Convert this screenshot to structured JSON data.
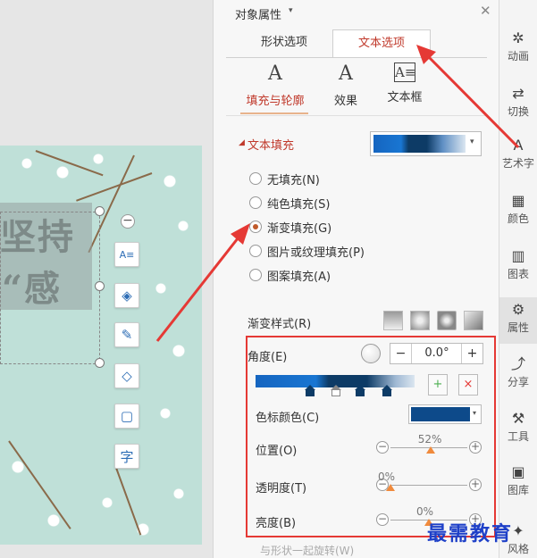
{
  "canvas": {
    "slide_text_line1": "坚持",
    "slide_text_line2": "“感",
    "float_tools": [
      {
        "icon": "text-style-icon",
        "glyph": "A≡"
      },
      {
        "icon": "layers-icon",
        "glyph": "◈"
      },
      {
        "icon": "brush-icon",
        "glyph": "✎"
      },
      {
        "icon": "fill-bucket-icon",
        "glyph": "◇"
      },
      {
        "icon": "frame-icon",
        "glyph": "▢"
      },
      {
        "icon": "font-icon",
        "glyph": "字"
      }
    ]
  },
  "panel": {
    "title": "对象属性",
    "title_caret": "▾",
    "close": "✕",
    "tabs": {
      "shape": "形状选项",
      "text": "文本选项"
    },
    "subtabs": {
      "fill_outline": {
        "icon": "A",
        "label": "填充与轮廓"
      },
      "effect": {
        "icon": "A",
        "label": "效果"
      },
      "textbox": {
        "icon": "A≡",
        "label": "文本框"
      }
    },
    "section": {
      "caret": "◢",
      "title": "文本填充"
    },
    "fill_dropdown_caret": "▾",
    "fill_options": [
      "无填充(N)",
      "纯色填充(S)",
      "渐变填充(G)",
      "图片或纹理填充(P)",
      "图案填充(A)"
    ],
    "fill_selected": "渐变填充(G)",
    "gradient_style_label": "渐变样式(R)",
    "angle": {
      "label": "角度(E)",
      "minus": "−",
      "value": "0.0°",
      "plus": "+"
    },
    "stop_buttons": {
      "add": "+",
      "delete": "×"
    },
    "stop_color": {
      "label": "色标颜色(C)",
      "color": "#0d4a8a",
      "caret": "▾"
    },
    "sliders": {
      "position": {
        "label": "位置(O)",
        "value": "52%",
        "fraction": 0.52
      },
      "transparency": {
        "label": "透明度(T)",
        "value": "0%",
        "fraction": 0.0
      },
      "brightness": {
        "label": "亮度(B)",
        "value": "0%",
        "fraction": 0.5
      }
    },
    "slider_minus": "−",
    "slider_plus": "+",
    "bottom_hint": "与形状一起旋转(W)"
  },
  "rail": [
    {
      "icon": "animation-icon",
      "glyph": "✲",
      "label": "动画"
    },
    {
      "icon": "transition-icon",
      "glyph": "⇄",
      "label": "切换"
    },
    {
      "icon": "wordart-icon",
      "glyph": "A",
      "label": "艺术字"
    },
    {
      "icon": "color-icon",
      "glyph": "▦",
      "label": "颜色"
    },
    {
      "icon": "chart-icon",
      "glyph": "▥",
      "label": "图表"
    },
    {
      "icon": "properties-icon",
      "glyph": "⚙",
      "label": "属性"
    },
    {
      "icon": "share-icon",
      "glyph": "⤴",
      "label": "分享"
    },
    {
      "icon": "tools-icon",
      "glyph": "⚒",
      "label": "工具"
    },
    {
      "icon": "gallery-icon",
      "glyph": "▣",
      "label": "图库"
    },
    {
      "icon": "style-icon",
      "glyph": "✦",
      "label": "风格"
    }
  ],
  "watermark": "最需教育",
  "colors": {
    "accent": "#c0392b",
    "annotation": "#e53935",
    "slider_thumb": "#f08a3c",
    "gradient_dark": "#0d3b66",
    "gradient_mid": "#1976d2"
  }
}
